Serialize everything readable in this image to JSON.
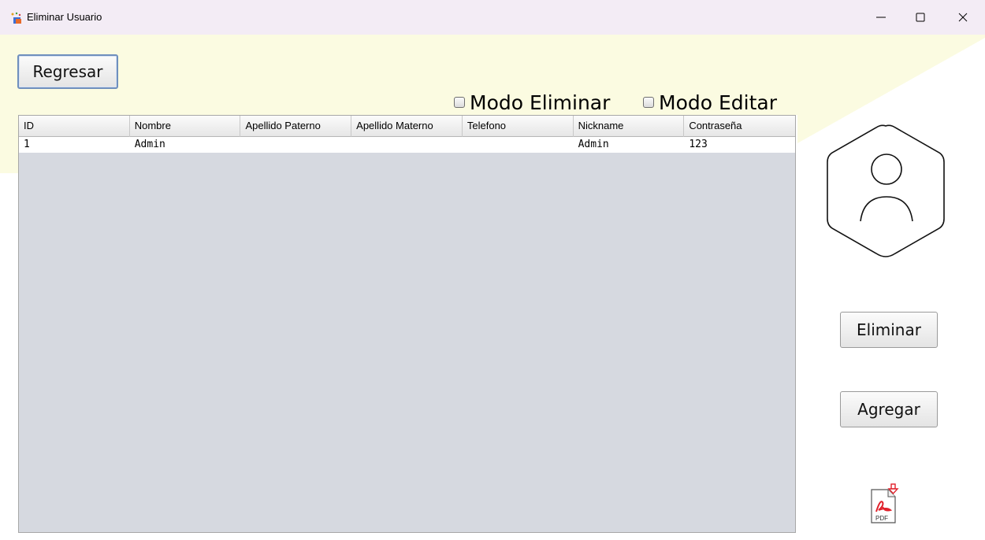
{
  "window": {
    "title": "Eliminar Usuario",
    "minimize_glyph": "—",
    "maximize_glyph": "☐",
    "close_glyph": "✕"
  },
  "buttons": {
    "regresar": "Regresar",
    "eliminar": "Eliminar",
    "agregar": "Agregar"
  },
  "checkboxes": {
    "modo_eliminar": "Modo Eliminar",
    "modo_editar": "Modo Editar"
  },
  "table": {
    "columns": [
      "ID",
      "Nombre",
      "Apellido Paterno",
      "Apellido Materno",
      "Telefono",
      "Nickname",
      "Contraseña"
    ],
    "rows": [
      [
        "1",
        "Admin",
        "",
        "",
        "",
        "Admin",
        "123"
      ]
    ]
  },
  "icons": {
    "app": "app-icon",
    "avatar": "user-avatar-icon",
    "pdf": "pdf-export-icon",
    "pdf_label": "PDF"
  },
  "colors": {
    "titlebar_bg": "#f3ecf5",
    "wedge": "#fbfbe1",
    "table_bg": "#d6d9e0",
    "pdf_red": "#e0202a"
  }
}
